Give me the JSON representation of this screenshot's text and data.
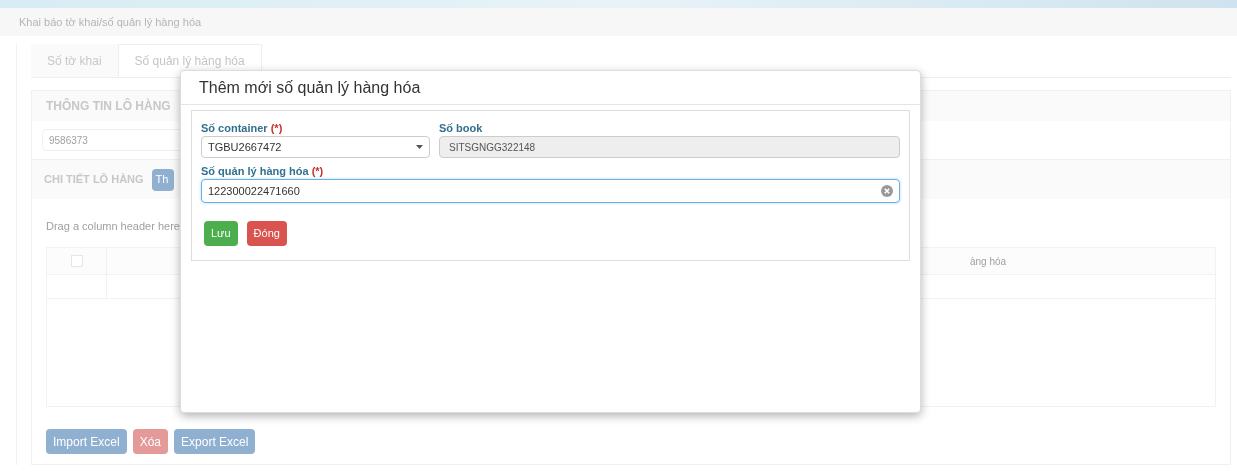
{
  "breadcrumb": "Khai báo tờ khai/số quản lý hàng hóa",
  "tabs": [
    {
      "label": "Số tờ khai",
      "selected": false
    },
    {
      "label": "Số quản lý hàng hóa",
      "selected": true
    }
  ],
  "shipment_info": {
    "title": "THÔNG TIN LÔ HÀNG",
    "value": "9586373"
  },
  "shipment_detail": {
    "title": "CHI TIẾT LÔ HÀNG",
    "add_button": "Th",
    "group_hint": "Drag a column header here",
    "grid": {
      "select_all_checked": false,
      "column_3": "àng hóa"
    }
  },
  "footer_buttons": [
    {
      "label": "Import Excel",
      "kind": "primary"
    },
    {
      "label": "Xóa",
      "kind": "danger"
    },
    {
      "label": "Export Excel",
      "kind": "primary"
    }
  ],
  "dialog": {
    "title": "Thêm mới số quản lý hàng hóa",
    "container": {
      "label": "Số container",
      "required_mark": "(*)",
      "value": "TGBU2667472"
    },
    "book": {
      "label": "Số book",
      "value": "SITSGNGG322148",
      "disabled": true
    },
    "cargo_number": {
      "label": "Số quản lý hàng hóa",
      "required_mark": "(*)",
      "value": "122300022471660"
    },
    "buttons": [
      {
        "label": "Lưu",
        "kind": "success"
      },
      {
        "label": "Đóng",
        "kind": "danger"
      }
    ]
  }
}
